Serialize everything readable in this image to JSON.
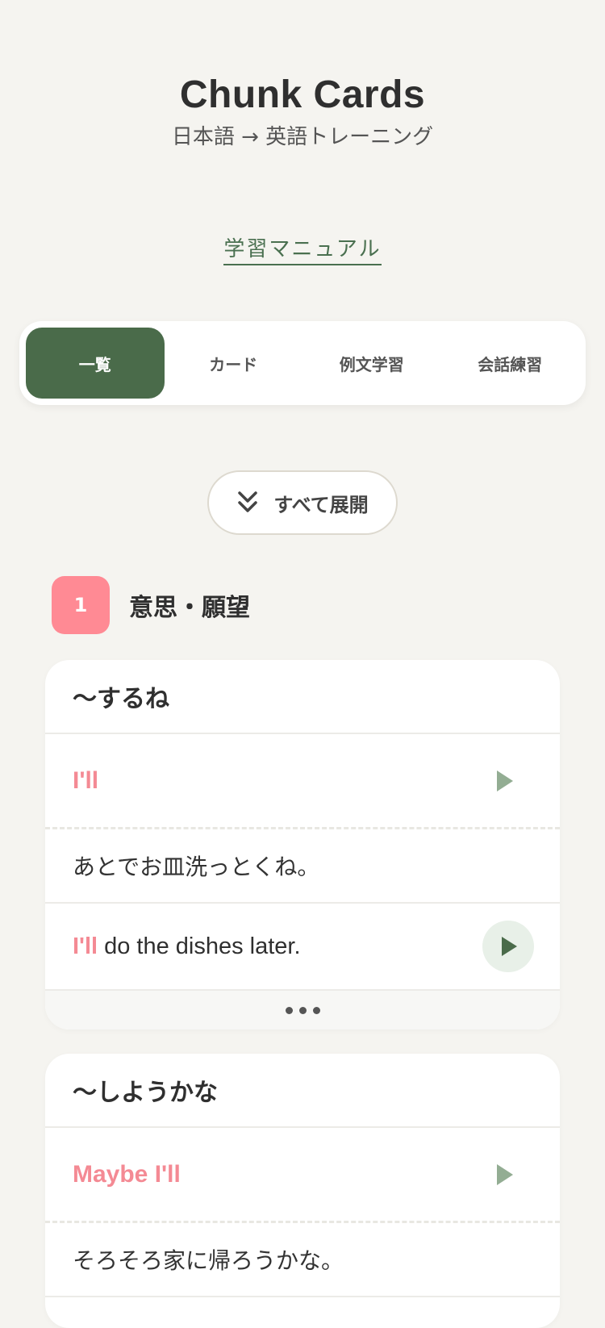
{
  "header": {
    "title": "Chunk Cards",
    "subtitle": "日本語 → 英語トレーニング"
  },
  "manual_link": "学習マニュアル",
  "tabs": [
    {
      "label": "一覧",
      "active": true
    },
    {
      "label": "カード",
      "active": false
    },
    {
      "label": "例文学習",
      "active": false
    },
    {
      "label": "会話練習",
      "active": false
    }
  ],
  "expand_button": {
    "label": "すべて展開",
    "icon": "double-chevron-down-icon"
  },
  "section": {
    "number": "1",
    "title": "意思・願望"
  },
  "cards": [
    {
      "heading": "〜するね",
      "chunk": "I'll",
      "japanese": "あとでお皿洗っとくね。",
      "english_highlight": "I'll",
      "english_rest": "do the dishes later."
    },
    {
      "heading": "〜しようかな",
      "chunk": "Maybe I'll",
      "japanese": "そろそろ家に帰ろうかな。"
    }
  ],
  "colors": {
    "accent_green": "#4a6b4a",
    "accent_pink": "#f48a94",
    "background": "#f5f4f0"
  }
}
